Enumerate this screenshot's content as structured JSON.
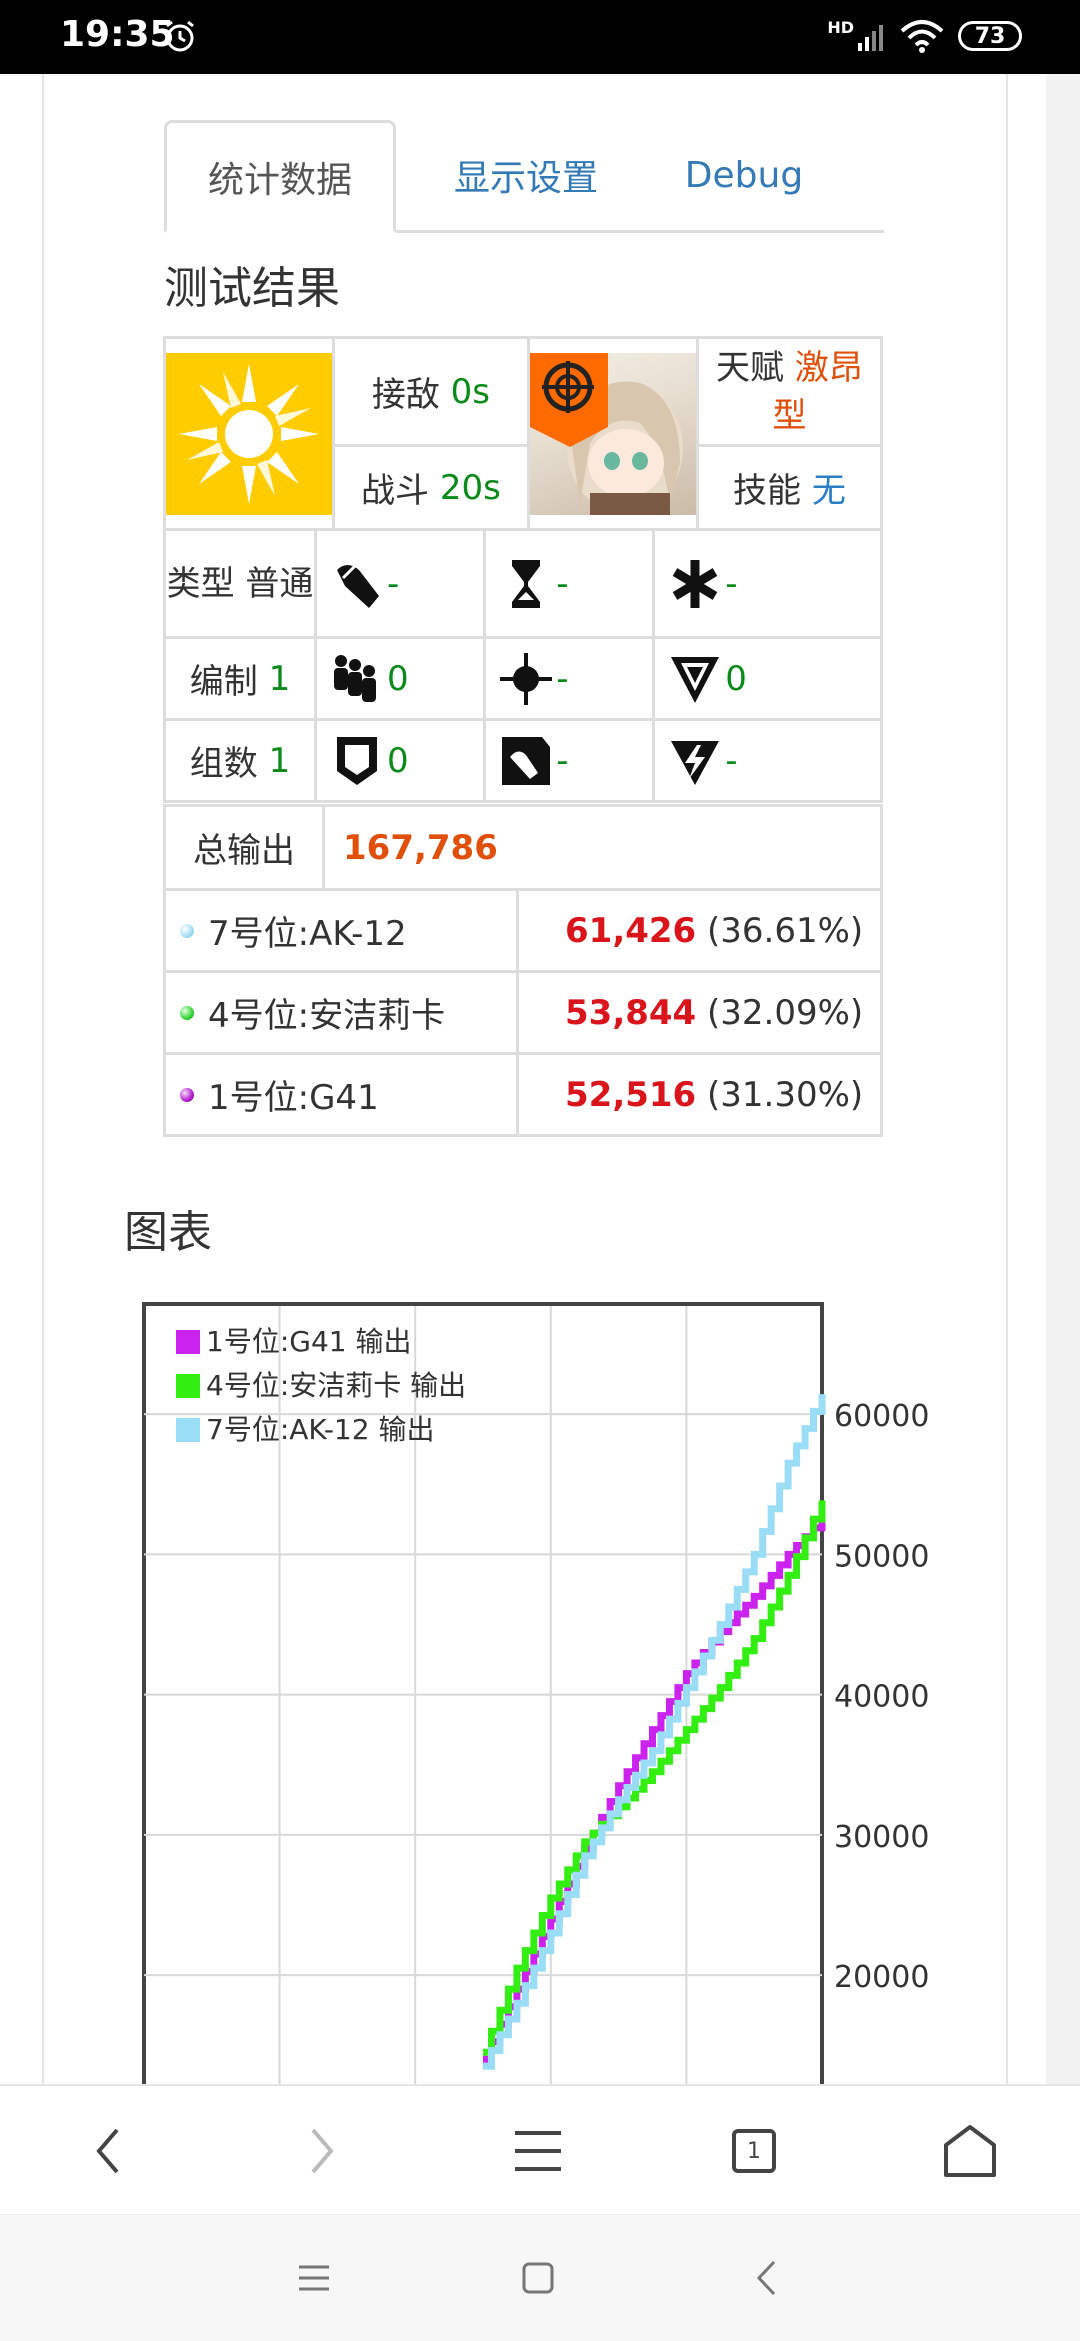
{
  "status_bar": {
    "time": "19:35",
    "battery": "73",
    "network": "HD",
    "icons": [
      "alarm-icon",
      "signal-icon",
      "wifi-icon",
      "battery-icon"
    ]
  },
  "tabs": [
    {
      "label": "统计数据",
      "active": true
    },
    {
      "label": "显示设置",
      "active": false
    },
    {
      "label": "Debug",
      "active": false
    }
  ],
  "results": {
    "title": "测试结果",
    "engage_label": "接敌",
    "engage_value": "0s",
    "battle_label": "战斗",
    "battle_value": "20s",
    "talent_label": "天赋",
    "talent_value": "激昂型",
    "skill_label": "技能",
    "skill_value": "无",
    "type_label": "类型",
    "type_value": "普通",
    "formation_label": "编制",
    "formation_value": "1",
    "groups_label": "组数",
    "groups_value": "1",
    "stats": {
      "bullet": "-",
      "hourglass": "-",
      "asterisk": "-",
      "team": "0",
      "crosshair": "-",
      "triangle": "0",
      "armor": "0",
      "pierce": "-",
      "lightning": "-"
    },
    "total_label": "总输出",
    "total_value": "167,786",
    "rows": [
      {
        "name": "7号位:AK-12",
        "value": "61,426",
        "pct": "(36.61%)",
        "color": "#a4dcf4"
      },
      {
        "name": "4号位:安洁莉卡",
        "value": "53,844",
        "pct": "(32.09%)",
        "color": "#2fd62f"
      },
      {
        "name": "1号位:G41",
        "value": "52,516",
        "pct": "(31.30%)",
        "color": "#b31ccf"
      }
    ]
  },
  "chart_section": {
    "title": "图表"
  },
  "chart_data": {
    "type": "line",
    "step": true,
    "legend_position": "top-left",
    "grid": true,
    "y_ticks": [
      "60000",
      "50000",
      "40000",
      "30000",
      "20000"
    ],
    "ylim": [
      13000,
      63000
    ],
    "xlim": [
      0,
      20
    ],
    "series": [
      {
        "name": "1号位:G41 输出",
        "color": "#cc22ee",
        "x": [
          10,
          11,
          12,
          13,
          14,
          15,
          16,
          17,
          18,
          19,
          20
        ],
        "y": [
          14000,
          19000,
          24000,
          29000,
          33500,
          37500,
          41500,
          44500,
          47000,
          50000,
          52516
        ]
      },
      {
        "name": "4号位:安洁莉卡 输出",
        "color": "#33ee11",
        "x": [
          10,
          11,
          12,
          13,
          14,
          15,
          16,
          17,
          18,
          19,
          20
        ],
        "y": [
          14500,
          20500,
          25500,
          29500,
          32000,
          34500,
          37500,
          40500,
          44000,
          48500,
          53844
        ]
      },
      {
        "name": "7号位:AK-12 输出",
        "color": "#99ddf7",
        "x": [
          10,
          11,
          12,
          13,
          14,
          15,
          16,
          17,
          18,
          19,
          20
        ],
        "y": [
          13500,
          18000,
          23000,
          28500,
          32500,
          36000,
          40500,
          45000,
          50000,
          56500,
          61426
        ]
      }
    ]
  },
  "bottom_nav": {
    "tab_count": "1",
    "icons": [
      "back-icon",
      "forward-icon",
      "menu-icon",
      "tabs-icon",
      "home-icon"
    ]
  },
  "system_nav": {
    "icons": [
      "recent-apps-icon",
      "home-square-icon",
      "system-back-icon"
    ]
  }
}
